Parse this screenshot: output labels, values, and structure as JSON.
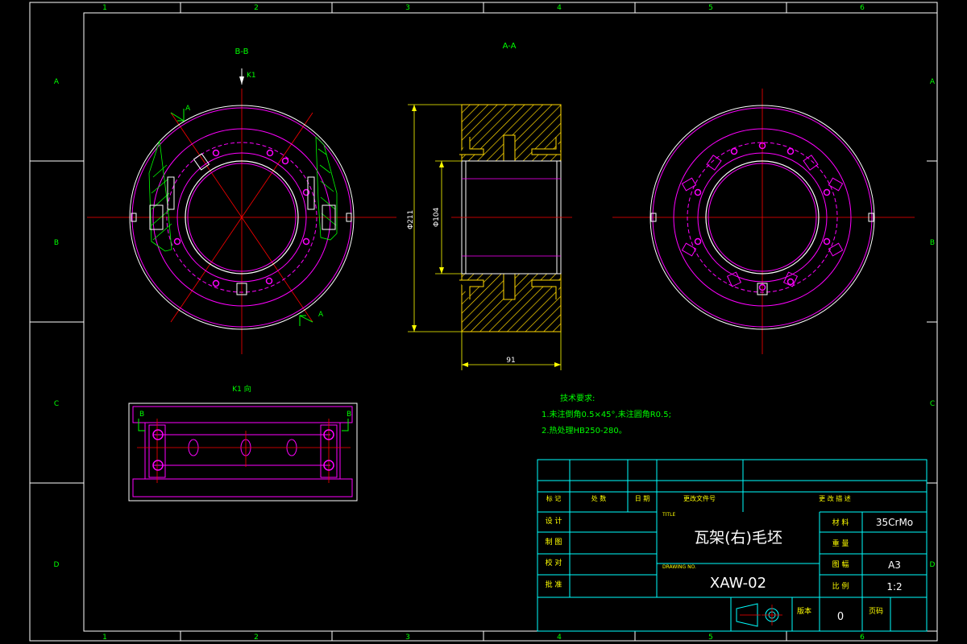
{
  "drawing": {
    "colors": {
      "background": "#000000",
      "border": "#ffffff",
      "zone_labels": "#00ff00",
      "centerline": "#ff0000",
      "feature": "#ff00ff",
      "section_hatch": "#ffd700",
      "outline": "#ffffff",
      "text_title": "#ffffff",
      "title_grid": "#00ffff",
      "dimension": "#ffff00",
      "annotation": "#00ff00"
    },
    "zones": {
      "columns": [
        "1",
        "2",
        "3",
        "4",
        "5",
        "6"
      ],
      "rows": [
        "A",
        "B",
        "C",
        "D"
      ]
    },
    "views": {
      "section_bb_label": "B-B",
      "section_aa_label": "A-A",
      "k1_arrow_label": "K1",
      "k1_view_label": "K1 向",
      "cut_mark_a": "A",
      "cut_mark_b": "B"
    },
    "dimensions": {
      "outer_diameter": "Φ211",
      "bore_diameter": "Φ104",
      "width": "91"
    },
    "tech_requirements": {
      "heading": "技术要求:",
      "line1": "1.未注倒角0.5×45°,未注圆角R0.5;",
      "line2": "2.热处理HB250-280。"
    },
    "title_block": {
      "rev_headers": [
        "标 记",
        "处 数",
        "日 期",
        "更改文件号",
        "更 改 描 述"
      ],
      "sign_rows": [
        "设 计",
        "制 图",
        "校 对",
        "批 准"
      ],
      "title_label": "TITLE",
      "title": "瓦架(右)毛坯",
      "drawing_no_label": "DRAWING NO.",
      "drawing_no": "XAW-02",
      "material_label": "材 料",
      "material": "35CrMo",
      "weight_label": "重 量",
      "weight": "",
      "size_label": "图 幅",
      "size": "A3",
      "scale_label": "比 例",
      "scale": "1:2",
      "version_label": "版本",
      "version": "0",
      "sheet_label": "页码",
      "sheet": ""
    }
  }
}
